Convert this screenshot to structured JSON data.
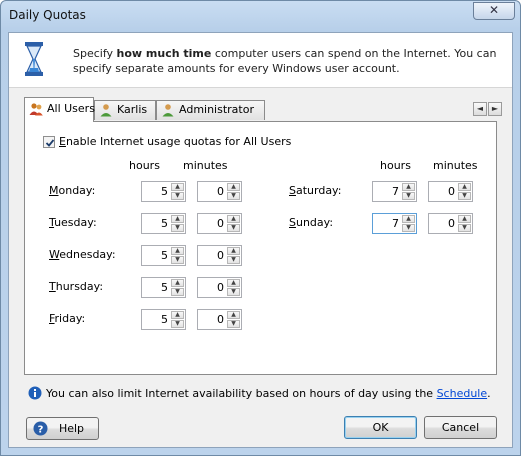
{
  "window": {
    "title": "Daily Quotas",
    "close_glyph": "✕"
  },
  "header": {
    "text_pre": "Specify ",
    "text_bold": "how much time",
    "text_post": " computer users can spend on the Internet. You can specify separate amounts for every Windows user account.",
    "icon": "hourglass-icon"
  },
  "tabs": [
    {
      "label": "All Users",
      "icon": "users-icon",
      "active": true
    },
    {
      "label": "Karlis",
      "icon": "user-icon",
      "active": false
    },
    {
      "label": "Administrator",
      "icon": "user-icon",
      "active": false
    }
  ],
  "tab_scroll": {
    "left": "◄",
    "right": "►"
  },
  "enable": {
    "checked": true,
    "label_first": "E",
    "label_rest": "nable Internet usage quotas for All Users"
  },
  "columns": {
    "hours": "hours",
    "minutes": "minutes"
  },
  "days": [
    {
      "key": "M",
      "rest": "onday:",
      "hours": "5",
      "minutes": "0"
    },
    {
      "key": "T",
      "rest": "uesday:",
      "hours": "5",
      "minutes": "0"
    },
    {
      "key": "W",
      "rest": "ednesday:",
      "hours": "5",
      "minutes": "0"
    },
    {
      "key": "T",
      "rest": "hursday:",
      "hours": "5",
      "minutes": "0"
    },
    {
      "key": "F",
      "rest": "riday:",
      "hours": "5",
      "minutes": "0"
    },
    {
      "key": "S",
      "rest": "aturday:",
      "hours": "7",
      "minutes": "0"
    },
    {
      "key": "S",
      "rest": "unday:",
      "hours": "7",
      "minutes": "0"
    }
  ],
  "info": {
    "text": "You can also limit Internet availability based on hours of day using the ",
    "link": "Schedule",
    "end": "."
  },
  "buttons": {
    "help": "Help",
    "ok": "OK",
    "cancel": "Cancel"
  },
  "colors": {
    "accent": "#0046d5",
    "titlebar": "#c9ddf2",
    "info_icon": "#1f5fb8"
  }
}
